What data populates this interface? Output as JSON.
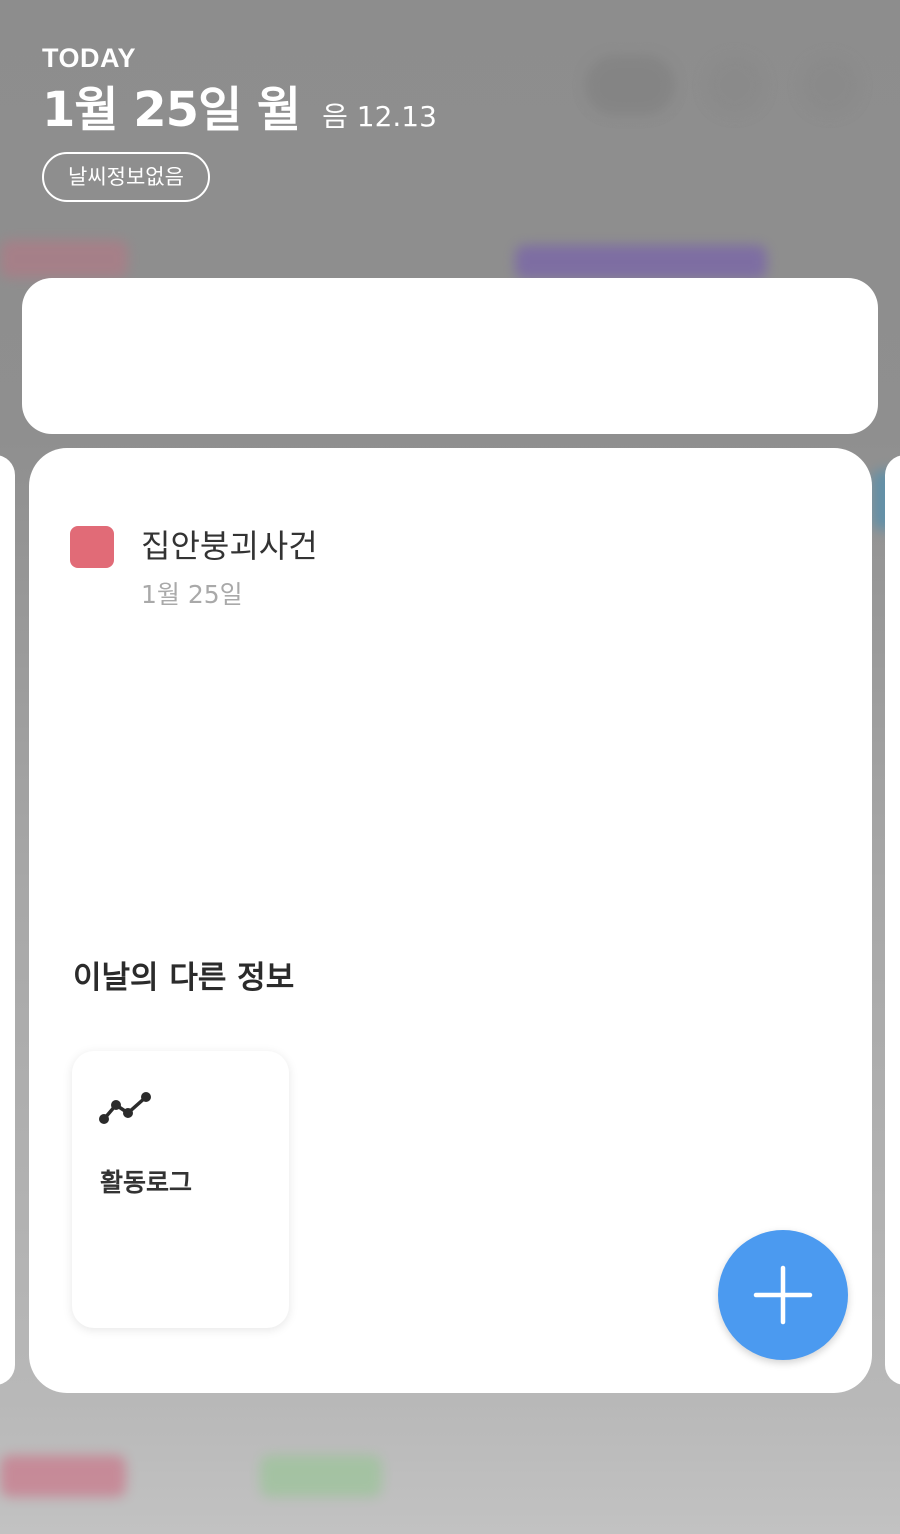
{
  "header": {
    "today_label": "TODAY",
    "date": "1월 25일 월",
    "lunar": "음 12.13",
    "weather": "날씨정보없음"
  },
  "event": {
    "title": "집안붕괴사건",
    "date": "1월 25일",
    "color": "#e16b77"
  },
  "section": {
    "title": "이날의 다른 정보"
  },
  "tiles": [
    {
      "label": "활동로그",
      "icon": "activity-log-icon"
    }
  ],
  "fab": {
    "icon": "plus-icon",
    "color": "#4b9af0"
  }
}
